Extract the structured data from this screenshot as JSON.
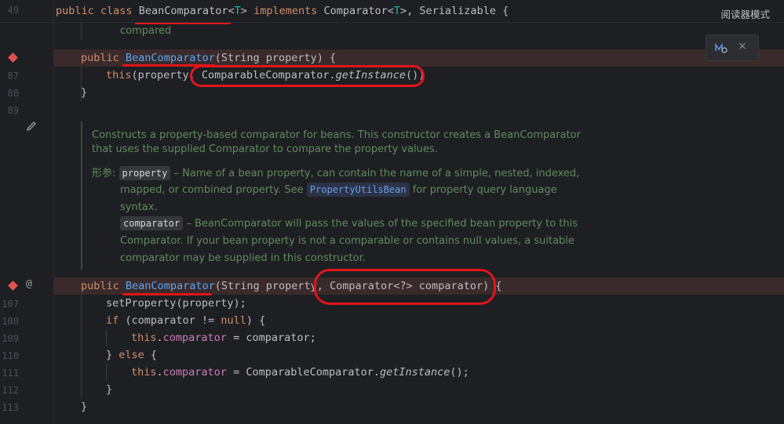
{
  "reader_mode": "阅读器模式",
  "line_numbers": {
    "l49": "49",
    "l87": "87",
    "l88": "88",
    "l89": "89",
    "l107": "107",
    "l108": "108",
    "l109": "109",
    "l110": "110",
    "l111": "111",
    "l112": "112",
    "l113": "113"
  },
  "code": {
    "class_decl": {
      "kw1": "public",
      "kw2": "class",
      "name": "BeanComparator",
      "lt": "<",
      "t1": "T",
      "gt": ">",
      "kw3": "implements",
      "rest1": "Comparator<",
      "t2": "T",
      "rest2": ">, Serializable {"
    },
    "folded_comment": "compared",
    "ctor1": {
      "kw": "public",
      "name": "BeanComparator",
      "params": "(String property) {"
    },
    "ctor1_body": {
      "kw": "this",
      "pre": "(property, ",
      "call": "ComparableComparator.",
      "method": "getInstance",
      "post": "())"
    },
    "close1": "}",
    "ctor2": {
      "kw": "public",
      "name": "BeanComparator",
      "params": "(String property, Comparator<?> comparator) {"
    },
    "l107": "setProperty(property);",
    "l108": {
      "kw": "if",
      "pre": " (comparator != ",
      "null": "null",
      "post": ") {"
    },
    "l109": {
      "kw": "this",
      "dot": ".",
      "fld": "comparator",
      "post": " = comparator;"
    },
    "l110": {
      "pre": "} ",
      "kw": "else",
      "post": " {"
    },
    "l111": {
      "kw": "this",
      "dot": ".",
      "fld": "comparator",
      "mid": " = ComparableComparator.",
      "method": "getInstance",
      "post": "();"
    },
    "l112": "}",
    "l113": "}"
  },
  "doc": {
    "line1": "Constructs a property-based comparator for beans. This constructor creates a BeanComparator",
    "line2": "that uses the supplied Comparator to compare the property values.",
    "params_label": "形参:",
    "p1_name": "property",
    "p1_text1": " – Name of a bean property, can contain the name of a simple, nested, indexed,",
    "p1_text2a": "mapped, or combined property. See ",
    "p1_link": "PropertyUtilsBean",
    "p1_text2b": " for property query language",
    "p1_text3": "syntax.",
    "p2_name": "comparator",
    "p2_text1": " – BeanComparator will pass the values of the specified bean property to this",
    "p2_text2": "Comparator. If your bean property is not a comparable or contains null values, a suitable",
    "p2_text3": "comparator may be supplied in this constructor."
  },
  "gutter_icons": {
    "gutter_at": "@"
  },
  "popup": {
    "close": "×"
  }
}
